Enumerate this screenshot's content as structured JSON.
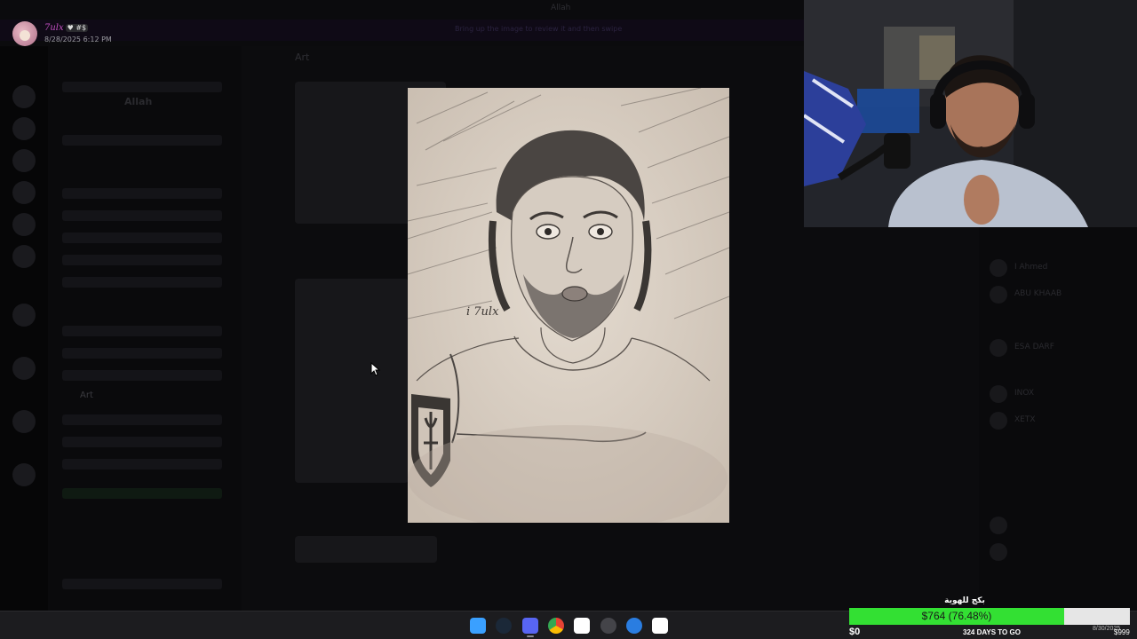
{
  "viewer": {
    "username": "7ulx",
    "badge": "♥ #$",
    "timestamp": "8/28/2025 6:12 PM"
  },
  "background_app": {
    "window_title": "Allah",
    "server_name": "Allah",
    "channel_name": "Art",
    "highlighted_channel": "Art",
    "banner_text": "Bring up the image to review it and then swipe",
    "members": [
      {
        "name": "I Ahmed"
      },
      {
        "name": "ABU KHAAB"
      },
      {
        "name": "ESA DARF"
      },
      {
        "name": "INOX"
      },
      {
        "name": "XETX"
      }
    ]
  },
  "artwork": {
    "signature": "i 7ulx"
  },
  "taskbar": {
    "apps": [
      {
        "name": "windows-start-icon",
        "color": "#3aa0ff"
      },
      {
        "name": "steam-icon",
        "color": "#1b2838"
      },
      {
        "name": "discord-icon",
        "color": "#5865f2",
        "badge": "9+"
      },
      {
        "name": "chrome-icon",
        "color": "#e84335"
      },
      {
        "name": "twitch-icon",
        "color": "#ffffff"
      },
      {
        "name": "obs-icon",
        "color": "#444449"
      },
      {
        "name": "sync-icon",
        "color": "#2a7de1"
      },
      {
        "name": "capcut-icon",
        "color": "#ffffff"
      }
    ]
  },
  "goal": {
    "title": "بكج للهوية",
    "amount_label": "$764 (76.48%)",
    "progress_percent": 76.48,
    "min_label": "$0",
    "max_label": "$999",
    "days_label": "324 DAYS TO GO",
    "date_label": "8/30/2025",
    "colors": {
      "fill": "#33e033",
      "track": "#e6e6e6"
    }
  }
}
